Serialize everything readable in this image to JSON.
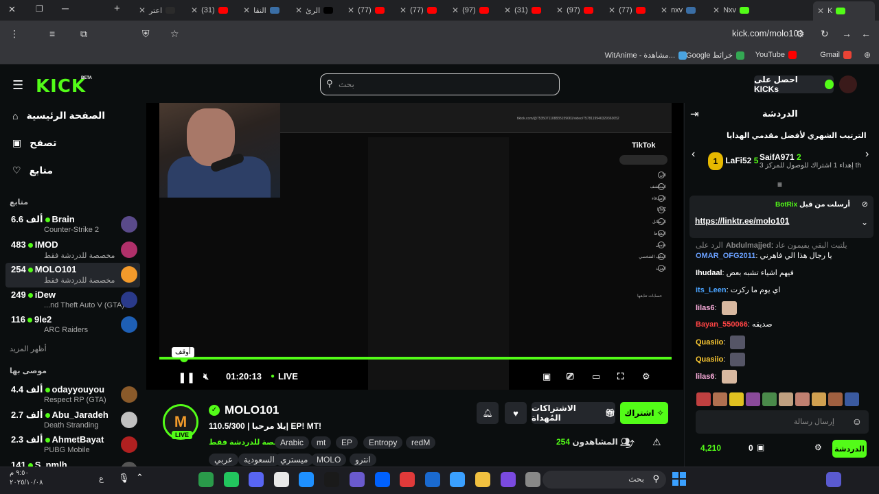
{
  "browser": {
    "tabs": [
      {
        "label": "اعتر",
        "color": "#2b2b2b"
      },
      {
        "label": "(31)",
        "color": "#ff0000"
      },
      {
        "label": "النقا",
        "color": "#3a6ea5"
      },
      {
        "label": "الرئ",
        "color": "#000000"
      },
      {
        "label": "(77)",
        "color": "#ff0000"
      },
      {
        "label": "(77)",
        "color": "#ff0000"
      },
      {
        "label": "(97)",
        "color": "#ff0000"
      },
      {
        "label": "(31)",
        "color": "#ff0000"
      },
      {
        "label": "(97)",
        "color": "#ff0000"
      },
      {
        "label": "(77)",
        "color": "#ff0000"
      },
      {
        "label": "nxv",
        "color": "#3a6ea5"
      },
      {
        "label": "Nxv",
        "color": "#53fc18"
      },
      {
        "label": "K",
        "color": "#53fc18"
      }
    ],
    "url": "kick.com/molo101",
    "extension_badge": "6",
    "bookmarks": [
      {
        "label": "Gmail",
        "color": "#ea4335"
      },
      {
        "label": "YouTube",
        "color": "#ff0000"
      },
      {
        "label": "Google خرائط",
        "color": "#34a853"
      },
      {
        "label": "WitAnime - مشاهدة...",
        "color": "#4aa3df"
      }
    ]
  },
  "header": {
    "logo": "KICK",
    "beta": "BETA",
    "search_placeholder": "بحث",
    "get_kicks_label": "احصل على KICKs"
  },
  "sidebar": {
    "nav": [
      {
        "label": "الصفحة الرئيسية",
        "icon": "home-icon"
      },
      {
        "label": "تصفح",
        "icon": "browse-icon"
      },
      {
        "label": "متابع",
        "icon": "heart-icon"
      }
    ],
    "following_heading": "متابع",
    "following": [
      {
        "name": "Brain",
        "viewers": "6.6 ألف",
        "category": "Counter-Strike 2",
        "color": "#5a4a8a"
      },
      {
        "name": "IMOD",
        "viewers": "483",
        "category": "مخصصة للدردشة فقط",
        "color": "#b0306a"
      },
      {
        "name": "MOLO101",
        "viewers": "254",
        "category": "مخصصة للدردشة فقط",
        "color": "#f39a2b"
      },
      {
        "name": "iDew",
        "viewers": "249",
        "category": "...nd Theft Auto V (GTA)",
        "color": "#2a3a8a"
      },
      {
        "name": "9le2",
        "viewers": "116",
        "category": "ARC Raiders",
        "color": "#1e5fb5"
      }
    ],
    "show_more": "أظهر المزيد",
    "recommended_heading": "موصى بها",
    "recommended": [
      {
        "name": "odayyouyou",
        "viewers": "4.4 ألف",
        "category": "Respect RP (GTA)",
        "color": "#8a5a2a"
      },
      {
        "name": "Abu_Jaradeh",
        "viewers": "2.7 ألف",
        "category": "Death Stranding",
        "color": "#c0c0c0"
      },
      {
        "name": "AhmetBayat",
        "viewers": "2.3 ألف",
        "category": "PUBG Mobile",
        "color": "#b02020"
      },
      {
        "name": "S_nmlh",
        "viewers": "141",
        "category": "",
        "color": "#555555"
      }
    ]
  },
  "video": {
    "tooltip": "أوقف",
    "time": "01:20:13",
    "live": "LIVE",
    "tiktok_label": "TikTok",
    "tiktok_url": "tiktok.com/@7535071108835159061/video/7578119946329363652",
    "tiktok_nav": [
      "الآن",
      "استكشف",
      "الأصدقاء",
      "LIVE",
      "الرسائل",
      "النشاط",
      "تحميل",
      "الملف الشخصي",
      "المزيد"
    ],
    "tiktok_following": "حسابات تتابعها"
  },
  "stream": {
    "channel": "MOLO101",
    "avatar_letter": "M",
    "live_badge": "LIVE",
    "title": "يلا مرحبا | 110.5/300| EP! MT!",
    "category": "مخصصة للدردشة فقط",
    "tags": [
      "redM",
      "Entropy",
      "EP",
      "mt",
      "Arabic",
      "انترو",
      "MOLO",
      "ميستري",
      "السعودية",
      "عربي"
    ],
    "follow_label": "اشتراك",
    "gift_label": "الاشتراكات المُهداة",
    "viewers_label": "المشاهدون",
    "viewers_count": "254"
  },
  "chat": {
    "title": "الدردشة",
    "gift_heading": "الترتيب الشهري لأفضل مقدمي الهدايا",
    "gifters": [
      {
        "name": "LaFi52",
        "count": "5",
        "rank": "1"
      },
      {
        "name": "SaifA971",
        "count": "2",
        "sub": "إهداء 1 اشتراك للوصول للمركز 3 th",
        "rank": "3"
      }
    ],
    "pinned": {
      "sent_by_label": "أرسلت من قبل",
      "bot": "BotRix",
      "link": "https://linktr.ee/molo101"
    },
    "messages": [
      {
        "user": "Abdulmajjed",
        "text": "يلتبت البقي يفيمون عاد",
        "color": "#888888",
        "reply": "الرد على"
      },
      {
        "user": "OMAR_OFG2011",
        "text": "يا رجال هذا الي فاهرني",
        "color": "#6aa0ff"
      },
      {
        "user": "Ihudaal",
        "text": "فيهم اشياء تشبه بعض",
        "color": "#ffffff"
      },
      {
        "user": "its_Leen",
        "text": "اي يوم ما ركزت",
        "color": "#4aa3ff"
      },
      {
        "user": "lilas6",
        "text": "",
        "color": "#ffb0e0"
      },
      {
        "user": "Bayan_550066",
        "text": "صديقه",
        "color": "#ff4444"
      },
      {
        "user": "Quasiio",
        "text": "",
        "color": "#ffcc33"
      },
      {
        "user": "Quasiio",
        "text": "",
        "color": "#ffcc33"
      },
      {
        "user": "lilas6",
        "text": "",
        "color": "#ffb0e0"
      }
    ],
    "input_placeholder": "إرسال رسالة",
    "send_label": "الدردشة",
    "points": "4,210",
    "zero": "0"
  },
  "taskbar": {
    "search_placeholder": "بحث",
    "time": "٩:٥٠ م",
    "date": "٢٠٢٥/١٠/٠٨",
    "lang": "ع"
  }
}
